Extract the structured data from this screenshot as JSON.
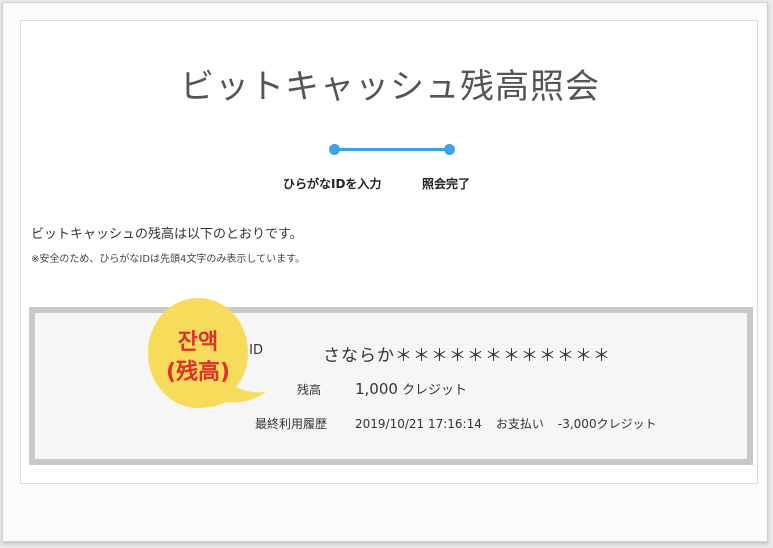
{
  "page": {
    "title": "ビットキャッシュ残高照会"
  },
  "steps": [
    {
      "label": "ひらがなIDを入力"
    },
    {
      "label": "照会完了"
    }
  ],
  "intro": {
    "lead": "ビットキャッシュの残高は以下のとおりです。",
    "note": "※安全のため、ひらがなIDは先頭4文字のみ表示しています。"
  },
  "result": {
    "id_label": "ID",
    "id_value": "さならか＊＊＊＊＊＊＊＊＊＊＊＊",
    "balance_label": "残高",
    "balance_amount": "1,000",
    "balance_unit": "クレジット",
    "history_label": "最終利用履歴",
    "history_datetime": "2019/10/21 17:16:14",
    "history_type": "お支払い",
    "history_amount": "-3,000クレジット"
  },
  "annotation": {
    "line1": "잔액",
    "line2": "(残高)",
    "fill_color": "#f7dc5c",
    "text_color": "#e0302b"
  },
  "colors": {
    "accent": "#3ea3e6",
    "box_border": "#c9c9c9"
  }
}
